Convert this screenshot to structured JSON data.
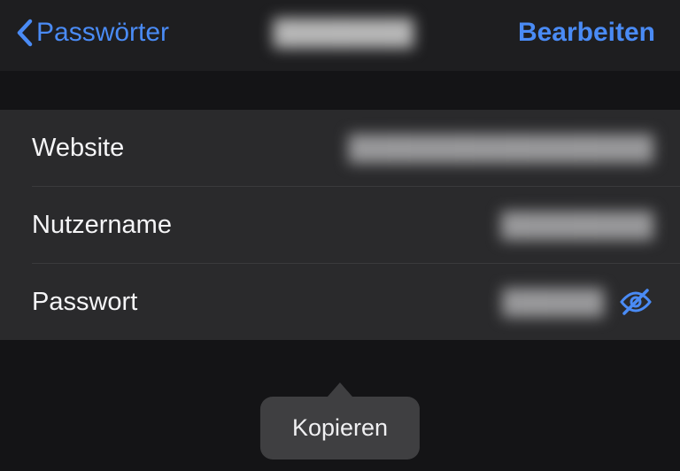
{
  "header": {
    "back_label": "Passwörter",
    "title": "████████",
    "edit_label": "Bearbeiten"
  },
  "rows": {
    "website": {
      "label": "Website",
      "value": "██████████████████"
    },
    "username": {
      "label": "Nutzername",
      "value": "█████████"
    },
    "password": {
      "label": "Passwort",
      "value": "██████"
    }
  },
  "popover": {
    "copy_label": "Kopieren"
  },
  "colors": {
    "accent": "#4a8bf5",
    "background": "#141416",
    "row_background": "#2a2a2c"
  }
}
